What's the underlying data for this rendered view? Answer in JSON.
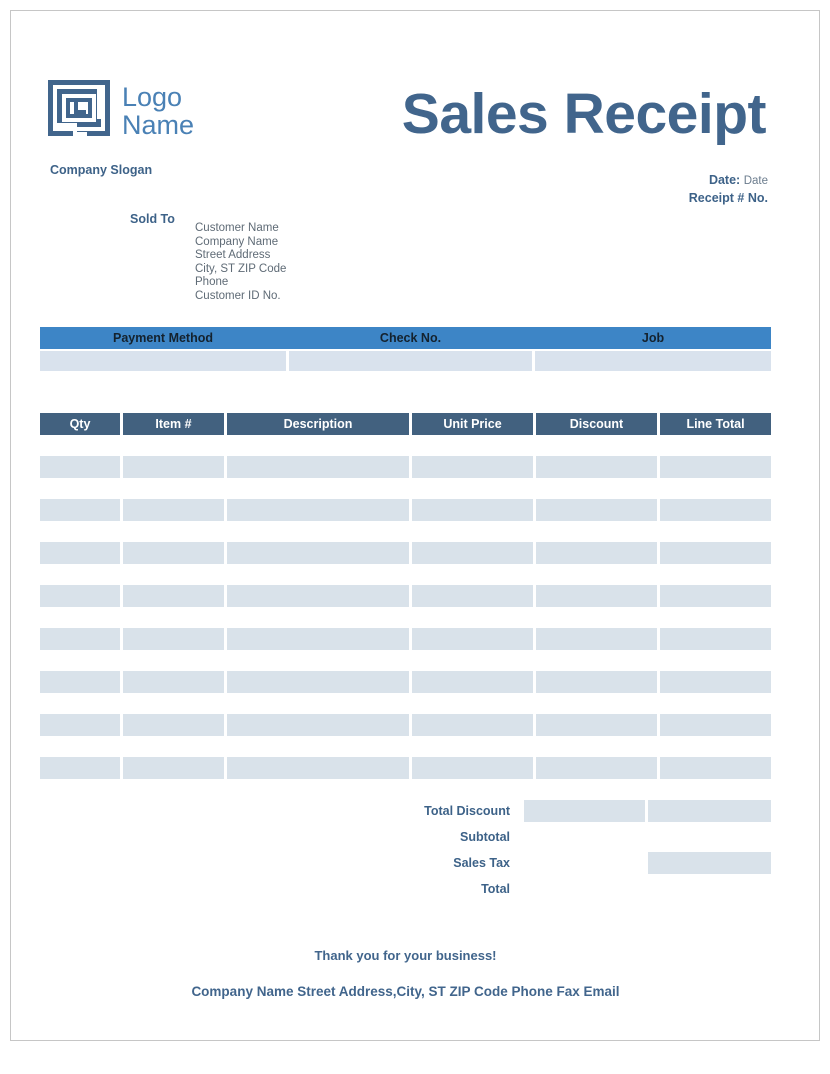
{
  "document": {
    "title": "Sales Receipt"
  },
  "brand": {
    "logo_icon": "maze-square-logo-icon",
    "logo_line1": "Logo",
    "logo_line2": "Name",
    "slogan": "Company Slogan",
    "logo_color": "#3d6288",
    "logo_text_color": "#4a81b5"
  },
  "meta": {
    "date_label": "Date:",
    "date_value": "Date",
    "receipt_label": "Receipt #",
    "receipt_value": "No."
  },
  "sold_to": {
    "label": "Sold To",
    "lines": [
      "Customer Name",
      "Company Name",
      "Street Address",
      "City, ST  ZIP Code",
      "Phone",
      "Customer ID No."
    ]
  },
  "payment": {
    "header_color": "#3d85c6",
    "columns": [
      {
        "label": "Payment Method",
        "value": ""
      },
      {
        "label": "Check No.",
        "value": ""
      },
      {
        "label": "Job",
        "value": ""
      }
    ]
  },
  "items": {
    "header_color": "#42617f",
    "cell_color": "#d9e2ea",
    "columns": [
      {
        "key": "qty",
        "label": "Qty"
      },
      {
        "key": "item",
        "label": "Item #"
      },
      {
        "key": "desc",
        "label": "Description"
      },
      {
        "key": "price",
        "label": "Unit Price"
      },
      {
        "key": "disc",
        "label": "Discount"
      },
      {
        "key": "total",
        "label": "Line Total"
      }
    ],
    "rows": [
      {
        "qty": "",
        "item": "",
        "desc": "",
        "price": "",
        "disc": "",
        "total": ""
      },
      {
        "qty": "",
        "item": "",
        "desc": "",
        "price": "",
        "disc": "",
        "total": ""
      },
      {
        "qty": "",
        "item": "",
        "desc": "",
        "price": "",
        "disc": "",
        "total": ""
      },
      {
        "qty": "",
        "item": "",
        "desc": "",
        "price": "",
        "disc": "",
        "total": ""
      },
      {
        "qty": "",
        "item": "",
        "desc": "",
        "price": "",
        "disc": "",
        "total": ""
      },
      {
        "qty": "",
        "item": "",
        "desc": "",
        "price": "",
        "disc": "",
        "total": ""
      },
      {
        "qty": "",
        "item": "",
        "desc": "",
        "price": "",
        "disc": "",
        "total": ""
      },
      {
        "qty": "",
        "item": "",
        "desc": "",
        "price": "",
        "disc": "",
        "total": ""
      }
    ]
  },
  "totals": [
    {
      "label": "Total Discount",
      "discount_value": "",
      "total_value": "",
      "has_discount_cell": true,
      "has_total_cell": true
    },
    {
      "label": "Subtotal",
      "discount_value": "",
      "total_value": "",
      "has_discount_cell": false,
      "has_total_cell": false
    },
    {
      "label": "Sales Tax",
      "discount_value": "",
      "total_value": "",
      "has_discount_cell": false,
      "has_total_cell": true
    },
    {
      "label": "Total",
      "discount_value": "",
      "total_value": "",
      "has_discount_cell": false,
      "has_total_cell": false
    }
  ],
  "footer": {
    "thank_you": "Thank you for your business!",
    "company_line": "Company Name  Street Address,City, ST  ZIP Code  Phone  Fax  Email"
  }
}
